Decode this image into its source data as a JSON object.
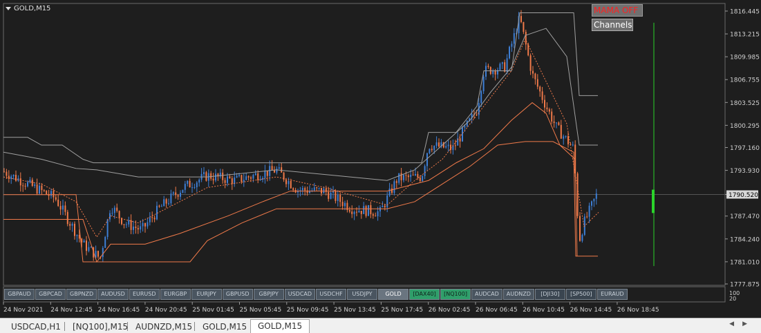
{
  "chart": {
    "symbol": "GOLD,M15",
    "price_labels": [
      "1816.445",
      "1813.215",
      "1809.985",
      "1806.755",
      "1803.525",
      "1800.295",
      "1797.160",
      "1793.930",
      "1790.520",
      "1787.470",
      "1784.240",
      "1781.010",
      "1777.875"
    ],
    "current_price": "1790.520",
    "time_labels": [
      "24 Nov 2021",
      "24 Nov 12:45",
      "24 Nov 16:45",
      "24 Nov 20:45",
      "25 Nov 01:45",
      "25 Nov 05:45",
      "25 Nov 09:45",
      "25 Nov 13:45",
      "25 Nov 17:45",
      "26 Nov 02:45",
      "26 Nov 06:45",
      "26 Nov 10:45",
      "26 Nov 14:45",
      "26 Nov 18:45"
    ],
    "indicator_labels": [
      "100",
      "20"
    ],
    "colors": {
      "up": "#3d7fd6",
      "down": "#f07a4a",
      "channel_outer": "#a0a0a0",
      "channel_inner": "#f07a4a",
      "volume": "#2bd42b",
      "background": "#1e1e1e"
    }
  },
  "buttons": {
    "mama": "MAMA OFF",
    "channels": "Channels"
  },
  "symbol_bar": [
    "GBPAUD",
    "GBPCAD",
    "GBPNZD",
    "AUDUSD",
    "EURUSD",
    "EURGBP",
    "EURJPY",
    "GBPUSD",
    "GBPJPY",
    "USDCAD",
    "USDCHF",
    "USDJPY",
    "GOLD",
    "[DAX40]",
    "[NQ100]",
    "AUDCAD",
    "AUDNZD",
    "[DJI30]",
    "[SP500]",
    "EURAUD"
  ],
  "tabs": [
    "USDCAD,H1",
    "[NQ100],M15",
    "AUDNZD,M15",
    "GOLD,M15",
    "GOLD,M15"
  ],
  "active_tab": 4
}
